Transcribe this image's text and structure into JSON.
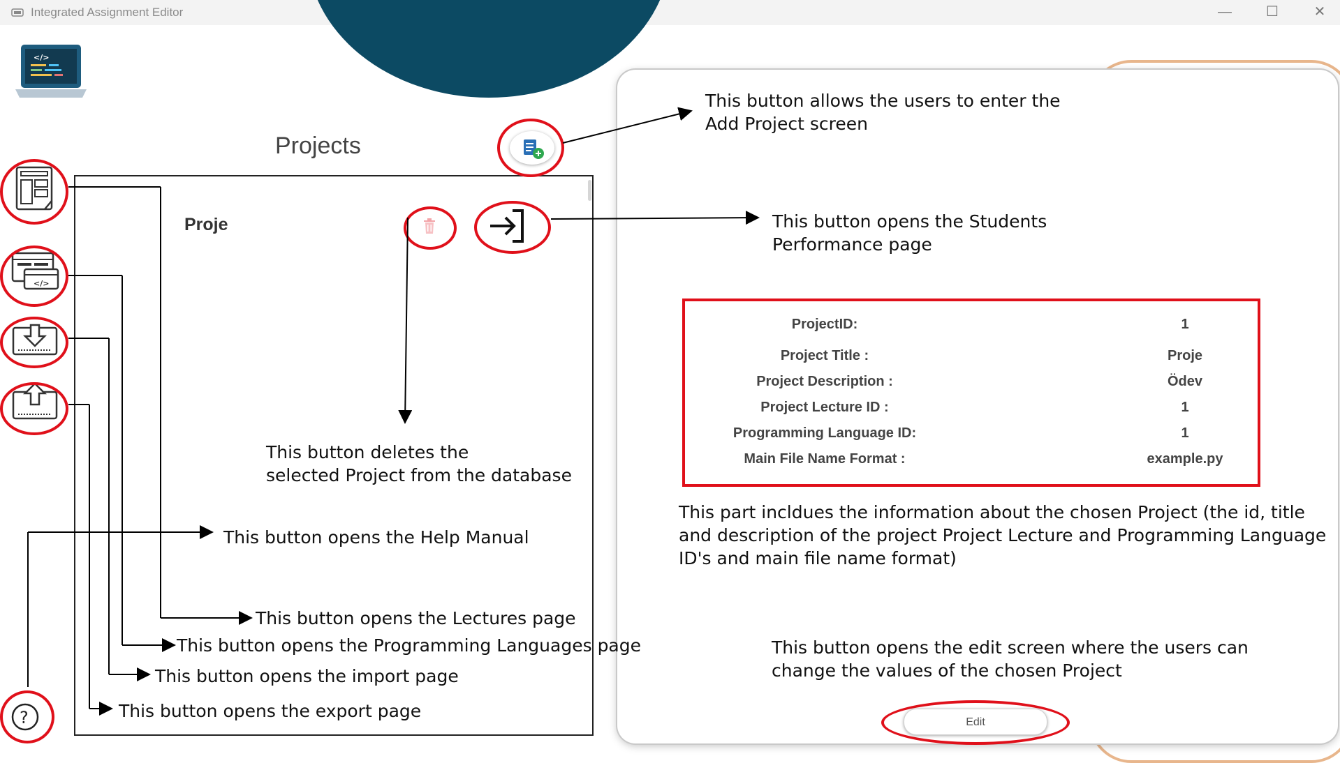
{
  "window": {
    "title": "Integrated Assignment Editor",
    "minimize_glyph": "—",
    "maximize_glyph": "☐",
    "close_glyph": "✕"
  },
  "colors": {
    "accent_dark": "#0c4a63",
    "highlight_red": "#e0101a",
    "orange_arc": "#e8b68c"
  },
  "sidebar": {
    "items": [
      {
        "icon": "lectures-icon"
      },
      {
        "icon": "programming-languages-icon"
      },
      {
        "icon": "import-icon"
      },
      {
        "icon": "export-icon"
      },
      {
        "icon": "help-icon"
      }
    ]
  },
  "projects": {
    "title": "Projects",
    "add_icon": "add-project-icon",
    "list": [
      {
        "name": "Proje",
        "delete_icon": "trash-icon",
        "open_icon": "open-arrow-icon"
      }
    ]
  },
  "details": {
    "rows": [
      {
        "label": "ProjectID:",
        "value": "1"
      },
      {
        "label": "Project Title :",
        "value": "Proje"
      },
      {
        "label": "Project Description :",
        "value": "Ödev"
      },
      {
        "label": "Project Lecture ID :",
        "value": "1"
      },
      {
        "label": "Programming Language ID:",
        "value": "1"
      },
      {
        "label": "Main File Name Format :",
        "value": "example.py"
      }
    ],
    "edit_label": "Edit"
  },
  "annotations": {
    "add_project": [
      "This button allows the users to  enter the",
      "Add Project screen"
    ],
    "students_performance": [
      "This button opens the Students",
      "Performance page"
    ],
    "delete": [
      "This button deletes the",
      "selected Project from the database"
    ],
    "help": "This button opens the Help Manual",
    "lectures": "This button opens the Lectures page",
    "languages": "This button opens the Programming Languages page",
    "import": "This button opens the import page",
    "export": "This button opens the export page",
    "info": [
      "This part incldues the information about the chosen Project (the id, title",
      "and description of the project Project Lecture and Programming Language",
      "ID's and main file name format)"
    ],
    "edit": [
      "This button opens the edit screen where the users can",
      "change the values of the chosen Project"
    ]
  }
}
